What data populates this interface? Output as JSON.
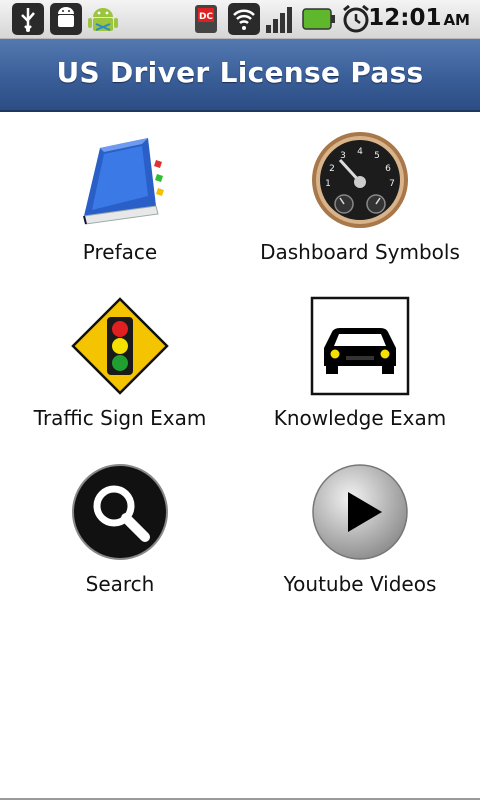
{
  "status_bar": {
    "icons": [
      "usb-icon",
      "android-debug-icon",
      "android-robot-icon",
      "dc-notification-icon",
      "wifi-icon",
      "signal-icon",
      "battery-icon",
      "alarm-icon"
    ],
    "time": "12:01",
    "ampm": "AM"
  },
  "header": {
    "title": "US Driver License Pass"
  },
  "menu": [
    {
      "label": "Preface",
      "icon": "book-icon"
    },
    {
      "label": "Dashboard Symbols",
      "icon": "speedometer-icon"
    },
    {
      "label": "Traffic Sign Exam",
      "icon": "traffic-light-sign-icon"
    },
    {
      "label": "Knowledge Exam",
      "icon": "car-icon"
    },
    {
      "label": "Search",
      "icon": "magnifier-icon"
    },
    {
      "label": "Youtube Videos",
      "icon": "play-icon"
    }
  ],
  "colors": {
    "title_bar": "#3a5e98",
    "traffic_sign": "#f5c400"
  }
}
